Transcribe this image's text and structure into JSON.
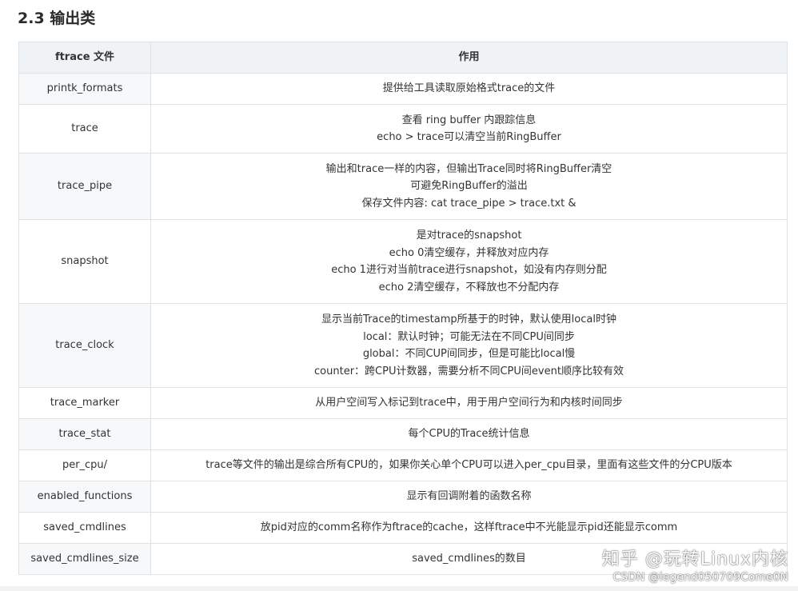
{
  "section": {
    "title": "2.3 输出类"
  },
  "table": {
    "headers": {
      "file": "ftrace 文件",
      "purpose": "作用"
    },
    "rows": [
      {
        "name": "printk_formats",
        "lines": [
          "提供给工具读取原始格式trace的文件"
        ]
      },
      {
        "name": "trace",
        "lines": [
          "查看 ring buffer 内跟踪信息",
          "echo > trace可以清空当前RingBuffer"
        ]
      },
      {
        "name": "trace_pipe",
        "lines": [
          "输出和trace一样的内容，但输出Trace同时将RingBuffer清空",
          "可避免RingBuffer的溢出",
          "保存文件内容: cat trace_pipe > trace.txt &"
        ]
      },
      {
        "name": "snapshot",
        "lines": [
          "是对trace的snapshot",
          "echo 0清空缓存，并释放对应内存",
          "echo 1进行对当前trace进行snapshot，如没有内存则分配",
          "echo 2清空缓存，不释放也不分配内存"
        ]
      },
      {
        "name": "trace_clock",
        "lines": [
          "显示当前Trace的timestamp所基于的时钟，默认使用local时钟",
          "local：默认时钟；可能无法在不同CPU间同步",
          "global：不同CUP间同步，但是可能比local慢",
          "counter：跨CPU计数器，需要分析不同CPU间event顺序比较有效"
        ]
      },
      {
        "name": "trace_marker",
        "lines": [
          "从用户空间写入标记到trace中，用于用户空间行为和内核时间同步"
        ]
      },
      {
        "name": "trace_stat",
        "lines": [
          "每个CPU的Trace统计信息"
        ]
      },
      {
        "name": "per_cpu/",
        "lines": [
          "trace等文件的输出是综合所有CPU的，如果你关心单个CPU可以进入per_cpu目录，里面有这些文件的分CPU版本"
        ]
      },
      {
        "name": "enabled_functions",
        "lines": [
          "显示有回调附着的函数名称"
        ]
      },
      {
        "name": "saved_cmdlines",
        "lines": [
          "放pid对应的comm名称作为ftrace的cache，这样ftrace中不光能显示pid还能显示comm"
        ]
      },
      {
        "name": "saved_cmdlines_size",
        "lines": [
          "saved_cmdlines的数目"
        ]
      }
    ]
  },
  "watermark": {
    "zhihu": "知乎 @玩转Linux内核",
    "csdn": "CSDN @legend050709Come0N"
  }
}
